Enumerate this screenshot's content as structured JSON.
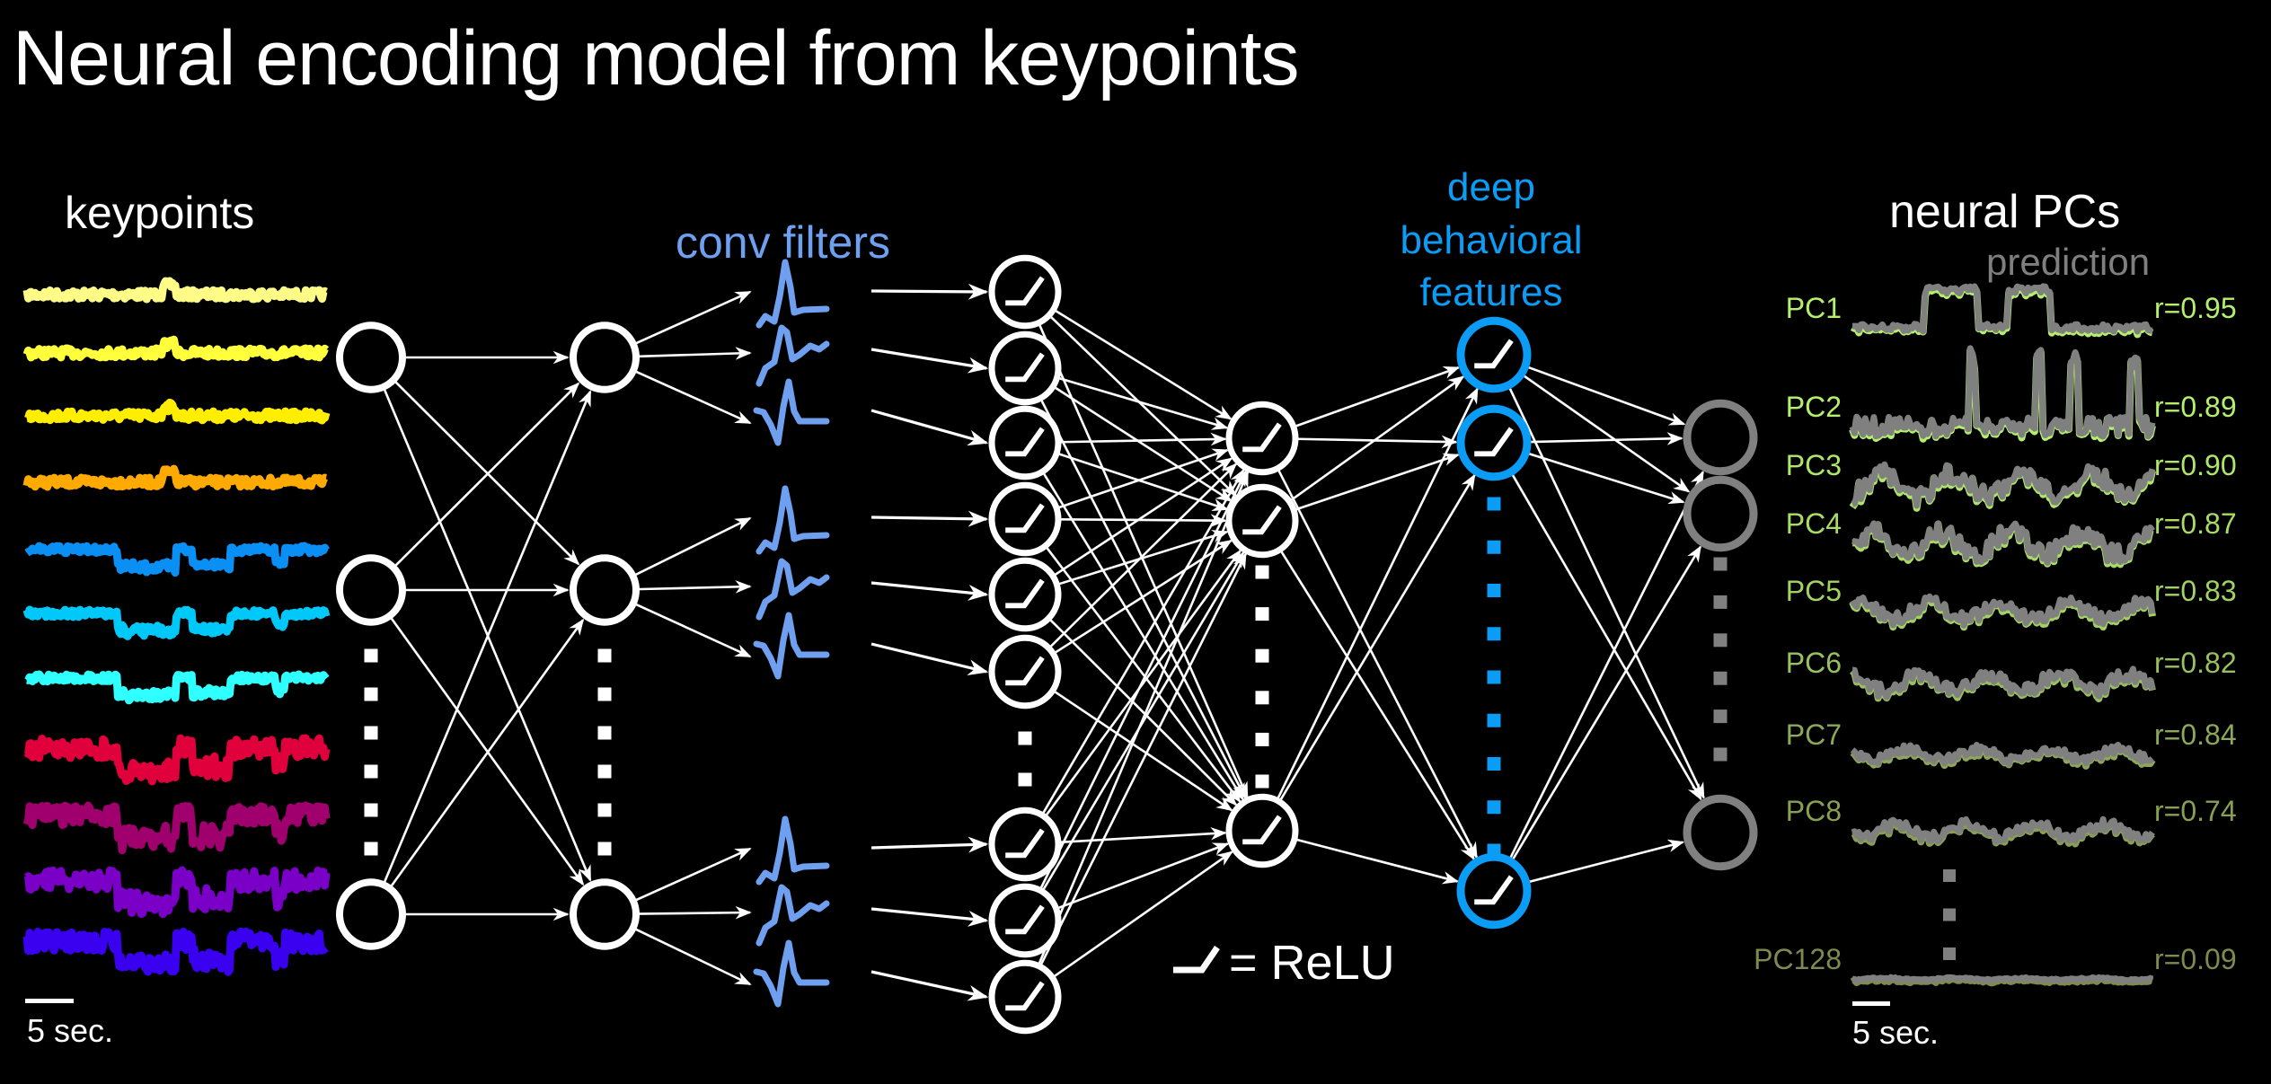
{
  "title": "Neural encoding model from keypoints",
  "sections": {
    "keypoints": "keypoints",
    "conv_filters": "conv filters",
    "deep_features": "deep behavioral features",
    "neural_pcs": "neural PCs",
    "prediction": "prediction"
  },
  "legend": {
    "relu_label": "= ReLU",
    "relu_icon": "relu-icon"
  },
  "scale_bars": {
    "keypoints": "5 sec.",
    "pcs": "5 sec."
  },
  "colors": {
    "background": "#000000",
    "node": "#ffffff",
    "deep_node": "#0b9cf5",
    "output_node": "#808080",
    "conv_filter": "#6fa0f0",
    "prediction": "#808080"
  },
  "keypoint_traces": [
    {
      "color": "#fffb87"
    },
    {
      "color": "#ffff3c"
    },
    {
      "color": "#ffee00"
    },
    {
      "color": "#ffaa00"
    },
    {
      "color": "#0a8ff5"
    },
    {
      "color": "#00c8f8"
    },
    {
      "color": "#30ffff"
    },
    {
      "color": "#e0003c"
    },
    {
      "color": "#a0006e"
    },
    {
      "color": "#7a00c8"
    },
    {
      "color": "#3a00f0"
    }
  ],
  "conv_filter_shapes": [
    "peak",
    "peak-wave",
    "biphasic",
    "peak",
    "peak-wave",
    "biphasic",
    "peak",
    "peak-wave",
    "biphasic"
  ],
  "neural_pcs": [
    {
      "label": "PC1",
      "r": "r=0.95",
      "color": "#b4f06e"
    },
    {
      "label": "PC2",
      "r": "r=0.89",
      "color": "#b4f06e"
    },
    {
      "label": "PC3",
      "r": "r=0.90",
      "color": "#aee66a"
    },
    {
      "label": "PC4",
      "r": "r=0.87",
      "color": "#a8dc66"
    },
    {
      "label": "PC5",
      "r": "r=0.83",
      "color": "#a2d262"
    },
    {
      "label": "PC6",
      "r": "r=0.82",
      "color": "#98c05e"
    },
    {
      "label": "PC7",
      "r": "r=0.84",
      "color": "#8ca858"
    },
    {
      "label": "PC8",
      "r": "r=0.74",
      "color": "#88a052"
    },
    {
      "label": "PC128",
      "r": "r=0.09",
      "color": "#7e8a4e"
    }
  ]
}
